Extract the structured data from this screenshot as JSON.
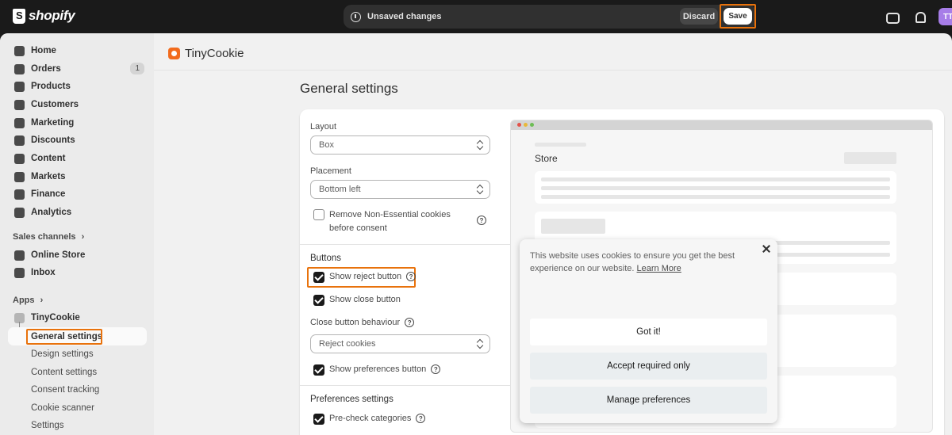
{
  "topbar": {
    "brand": "shopify",
    "unsaved_text": "Unsaved changes",
    "discard_label": "Discard",
    "save_label": "Save",
    "avatar_initials": "TT"
  },
  "sidebar": {
    "items": [
      {
        "label": "Home",
        "icon": "home-icon"
      },
      {
        "label": "Orders",
        "icon": "orders-icon",
        "badge": "1"
      },
      {
        "label": "Products",
        "icon": "tag-icon"
      },
      {
        "label": "Customers",
        "icon": "person-icon"
      },
      {
        "label": "Marketing",
        "icon": "target-icon"
      },
      {
        "label": "Discounts",
        "icon": "discount-icon"
      },
      {
        "label": "Content",
        "icon": "content-icon"
      },
      {
        "label": "Markets",
        "icon": "globe-icon"
      },
      {
        "label": "Finance",
        "icon": "bank-icon"
      },
      {
        "label": "Analytics",
        "icon": "bar-chart-icon"
      }
    ],
    "sales_channels_title": "Sales channels",
    "sales_channels": [
      {
        "label": "Online Store",
        "icon": "store-icon"
      },
      {
        "label": "Inbox",
        "icon": "inbox-icon"
      }
    ],
    "apps_title": "Apps",
    "app_name": "TinyCookie",
    "app_subitems": [
      "General settings",
      "Design settings",
      "Content settings",
      "Consent tracking",
      "Cookie scanner",
      "Settings"
    ]
  },
  "main": {
    "app_title": "TinyCookie",
    "page_title": "General settings",
    "layout_label": "Layout",
    "layout_value": "Box",
    "placement_label": "Placement",
    "placement_value": "Bottom left",
    "remove_cookies_label": "Remove Non-Essential cookies before consent",
    "buttons_heading": "Buttons",
    "show_reject_label": "Show reject button",
    "show_close_label": "Show close button",
    "close_behaviour_label": "Close button behaviour",
    "close_behaviour_value": "Reject cookies",
    "show_preferences_label": "Show preferences button",
    "preferences_heading": "Preferences settings",
    "precheck_label": "Pre-check categories"
  },
  "preview": {
    "store_label": "Store",
    "popup_text": "This website uses cookies to ensure you get the best experience on our website.",
    "popup_link": "Learn More",
    "got_it": "Got it!",
    "accept_required": "Accept required only",
    "manage_preferences": "Manage preferences"
  },
  "colors": {
    "highlight": "#e8720c",
    "app_accent": "#f26b1d",
    "avatar": "#a77de8"
  }
}
